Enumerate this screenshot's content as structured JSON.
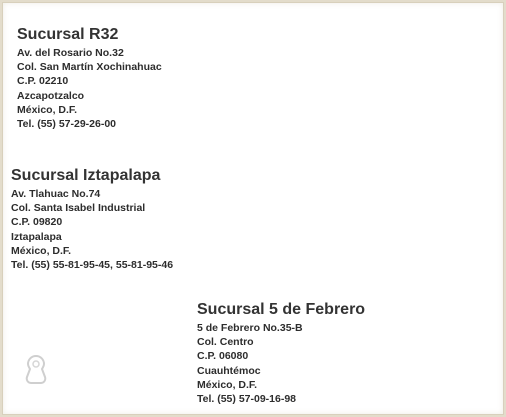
{
  "branches": [
    {
      "name": "Sucursal R32",
      "lines": [
        "Av. del Rosario No.32",
        "Col. San Martín Xochinahuac",
        "C.P. 02210",
        "Azcapotzalco",
        "México, D.F.",
        "Tel. (55) 57-29-26-00"
      ]
    },
    {
      "name": "Sucursal Iztapalapa",
      "lines": [
        "Av. Tlahuac No.74",
        "Col. Santa Isabel Industrial",
        "C.P. 09820",
        "Iztapalapa",
        "México, D.F.",
        "Tel. (55) 55-81-95-45, 55-81-95-46"
      ]
    },
    {
      "name": "Sucursal 5 de Febrero",
      "lines": [
        "5 de Febrero No.35-B",
        "Col. Centro",
        "C.P. 06080",
        "Cuauhtémoc",
        "México, D.F.",
        "Tel. (55) 57-09-16-98"
      ]
    }
  ],
  "icons": {
    "pin": "map-pin-icon"
  },
  "colors": {
    "background": "#e3dccb",
    "card": "#ffffff",
    "text": "#2d2d2d",
    "pin": "#cfcfcf"
  }
}
